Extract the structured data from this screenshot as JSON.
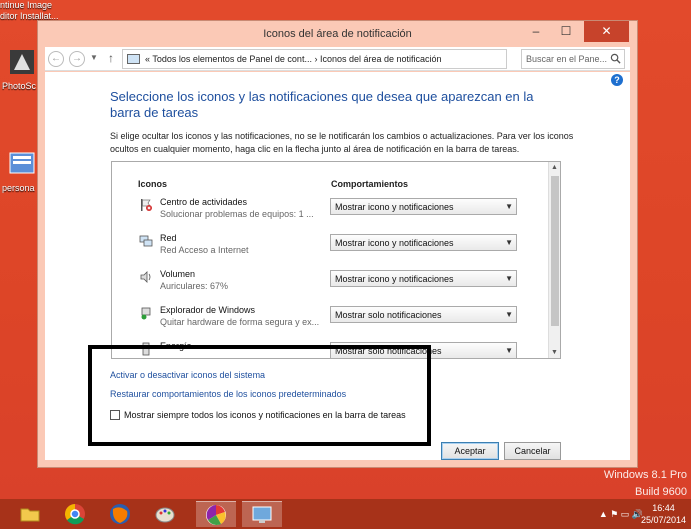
{
  "desktop": {
    "top_lines": [
      "ntinue Image",
      "ditor Installat..."
    ],
    "icons": [
      {
        "label": "PhotoSc"
      },
      {
        "label": "persona"
      }
    ],
    "os_version": [
      "Windows 8.1 Pro",
      "Build 9600"
    ]
  },
  "window": {
    "title": "Iconos del área de notificación",
    "controls": {
      "minimize": "–",
      "maximize": "☐",
      "close": "✕"
    }
  },
  "address": {
    "path": "«  Todos los elementos de Panel de cont...  ›  Iconos del área de notificación",
    "search_placeholder": "Buscar en el Pane..."
  },
  "main": {
    "heading": "Seleccione los iconos y las notificaciones que desea que aparezcan en la barra de tareas",
    "description": "Si elige ocultar los iconos y las notificaciones, no se le notificarán los cambios o actualizaciones. Para ver los iconos ocultos en cualquier momento, haga clic en la flecha junto al área de notificación en la barra de tareas.",
    "col_icons": "Iconos",
    "col_behaviors": "Comportamientos",
    "rows": [
      {
        "name": "Centro de actividades",
        "sub": "Solucionar problemas de equipos: 1 ...",
        "behavior": "Mostrar icono y notificaciones",
        "icon": "flag-icon"
      },
      {
        "name": "Red",
        "sub": "Red Acceso a Internet",
        "behavior": "Mostrar icono y notificaciones",
        "icon": "network-icon"
      },
      {
        "name": "Volumen",
        "sub": "Auriculares: 67%",
        "behavior": "Mostrar icono y notificaciones",
        "icon": "speaker-icon"
      },
      {
        "name": "Explorador de Windows",
        "sub": "Quitar hardware de forma segura y ex...",
        "behavior": "Mostrar solo notificaciones",
        "icon": "usb-icon"
      },
      {
        "name": "Energía",
        "sub": "",
        "behavior": "Mostrar solo notificaciones",
        "icon": "power-icon"
      }
    ],
    "link_system": "Activar o desactivar iconos del sistema",
    "link_restore": "Restaurar comportamientos de los iconos predeterminados",
    "checkbox_label": "Mostrar siempre todos los iconos y notificaciones en la barra de tareas",
    "accept": "Aceptar",
    "cancel": "Cancelar"
  },
  "taskbar": {
    "time": "16:44",
    "date": "25/07/2014",
    "tray": "▲ ⚑ ▭ 🔊"
  }
}
